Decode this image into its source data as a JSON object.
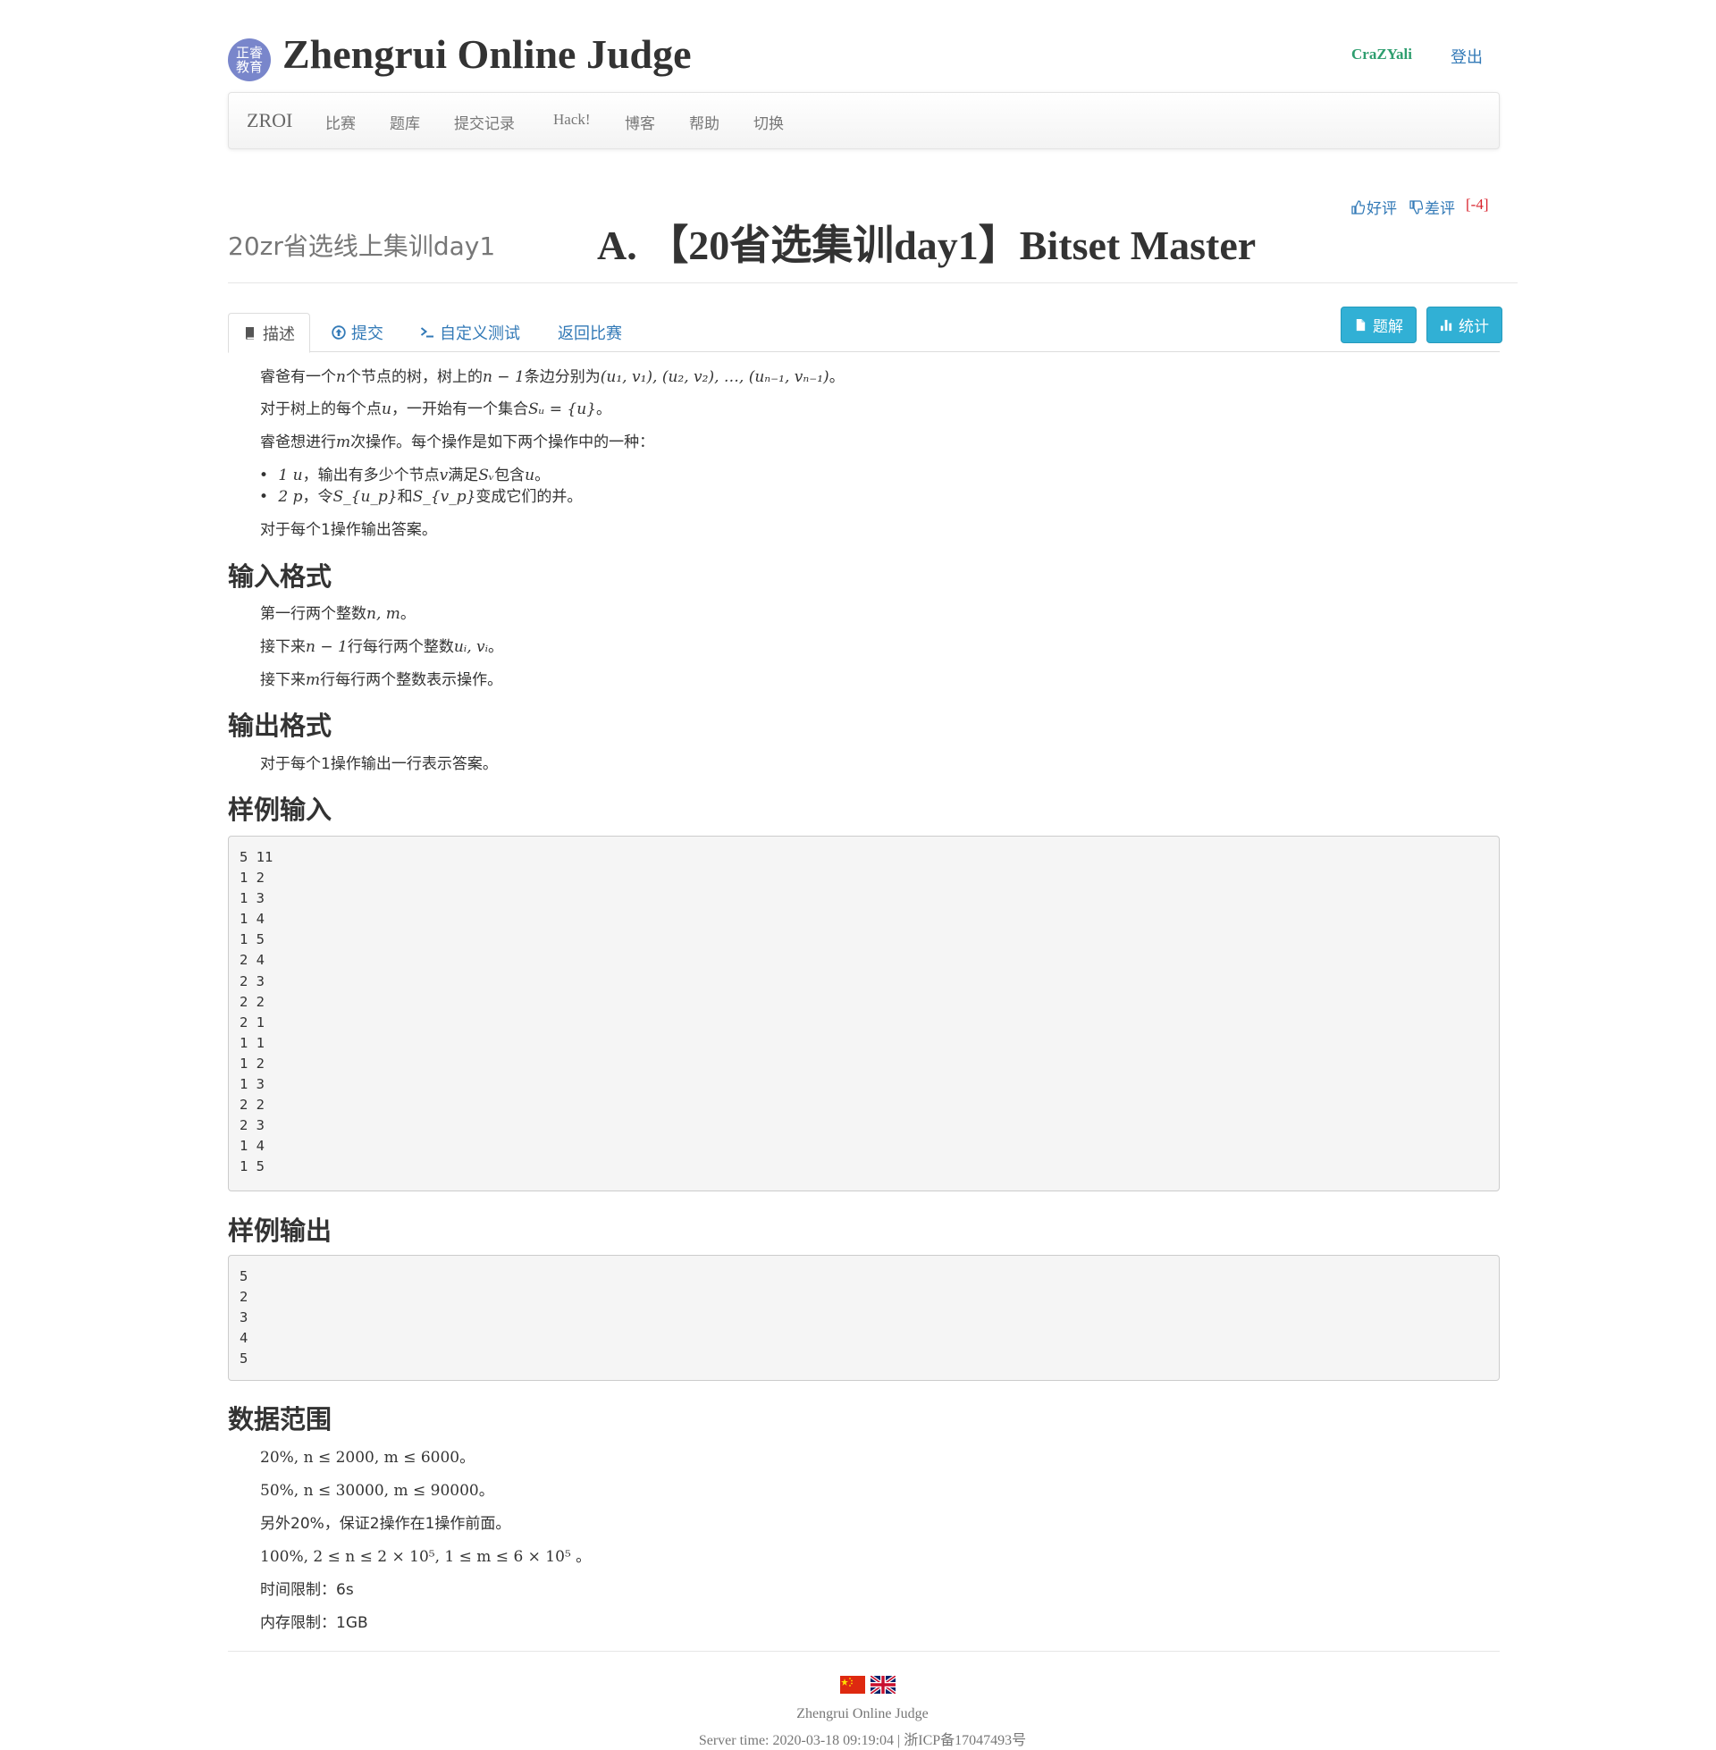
{
  "header": {
    "logo_text": "正睿\n教育",
    "site_title": "Zhengrui Online Judge",
    "username": "CraZYali",
    "logout": "登出"
  },
  "navbar": {
    "brand": "ZROI",
    "items": [
      "比赛",
      "题库",
      "提交记录",
      "Hack!",
      "博客",
      "帮助",
      "切换"
    ]
  },
  "problem": {
    "contest_name": "20zr省选线上集训day1",
    "title": "A. 【20省选集训day1】Bitset Master",
    "upvote": "好评",
    "downvote": "差评",
    "vote_count": "[-4]"
  },
  "tabs": {
    "description": "描述",
    "submit": "提交",
    "custom_test": "自定义测试",
    "back": "返回比赛",
    "solution_btn": "题解",
    "stats_btn": "统计"
  },
  "statement": {
    "p1_a": "睿爸有一个",
    "p1_n": "n",
    "p1_b": "个节点的树，树上的",
    "p1_c": "n − 1",
    "p1_d": "条边分别为",
    "p1_e": "(u₁, v₁), (u₂, v₂), …, (uₙ₋₁, vₙ₋₁)",
    "p1_f": "。",
    "p2_a": "对于树上的每个点",
    "p2_u": "u",
    "p2_b": "，一开始有一个集合",
    "p2_c": "Sᵤ = {u}",
    "p2_d": "。",
    "p3_a": "睿爸想进行",
    "p3_m": "m",
    "p3_b": "次操作。每个操作是如下两个操作中的一种：",
    "op1_a": "1 u",
    "op1_b": "，输出有多少个节点",
    "op1_v": "v",
    "op1_c": "满足",
    "op1_s": "Sᵥ",
    "op1_d": "包含",
    "op1_u": "u",
    "op1_e": "。",
    "op2_a": "2 p",
    "op2_b": "，令",
    "op2_s1": "S_{u_p}",
    "op2_c": "和",
    "op2_s2": "S_{v_p}",
    "op2_d": "变成它们的并。",
    "p4": "对于每个1操作输出答案。"
  },
  "input_format": {
    "heading": "输入格式",
    "l1_a": "第一行两个整数",
    "l1_m": "n, m",
    "l1_b": "。",
    "l2_a": "接下来",
    "l2_m": "n − 1",
    "l2_b": "行每行两个整数",
    "l2_c": "uᵢ, vᵢ",
    "l2_d": "。",
    "l3_a": "接下来",
    "l3_m": "m",
    "l3_b": "行每行两个整数表示操作。"
  },
  "output_format": {
    "heading": "输出格式",
    "l1": "对于每个1操作输出一行表示答案。"
  },
  "sample_input": {
    "heading": "样例输入",
    "lines": [
      "5 11",
      "1 2",
      "1 3",
      "1 4",
      "1 5",
      "2 4",
      "2 3",
      "2 2",
      "2 1",
      "1 1",
      "1 2",
      "1 3",
      "2 2",
      "2 3",
      "1 4",
      "1 5"
    ]
  },
  "sample_output": {
    "heading": "样例输出",
    "lines": [
      "5",
      "2",
      "3",
      "4",
      "5"
    ]
  },
  "constraints": {
    "heading": "数据范围",
    "l1": "20%, n ≤ 2000, m ≤ 6000。",
    "l2": "50%, n ≤ 30000, m ≤ 90000。",
    "l3": "另外20%，保证2操作在1操作前面。",
    "l4": "100%, 2 ≤ n ≤ 2 × 10⁵, 1 ≤ m ≤ 6 × 10⁵ 。",
    "time_limit": "时间限制：6s",
    "memory_limit": "内存限制：1GB"
  },
  "footer": {
    "site_name": "Zhengrui Online Judge",
    "server_time": "Server time: 2020-03-18 09:19:04  |  浙ICP备17047493号"
  },
  "colors": {
    "link": "#337ab7",
    "username": "#2e9e6f",
    "vote_count": "#d9232d",
    "info_button": "#31b0d5"
  }
}
